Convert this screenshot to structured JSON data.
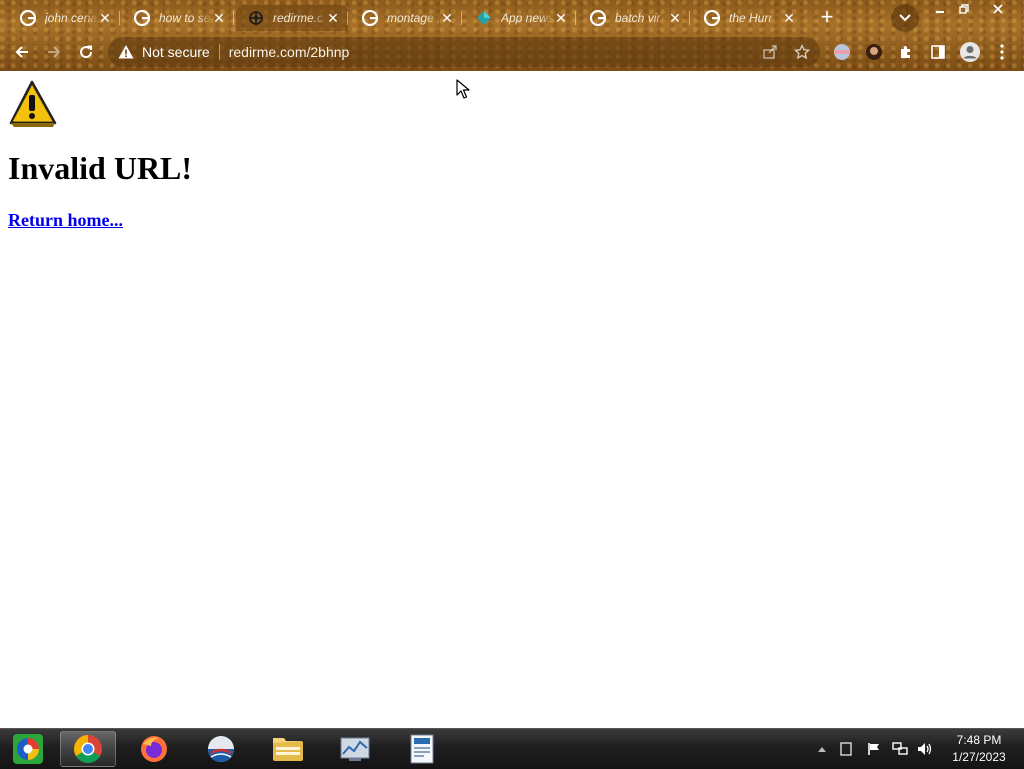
{
  "browser": {
    "tabs": [
      {
        "title": "john cena",
        "favicon": "google-icon"
      },
      {
        "title": "how to se",
        "favicon": "google-icon"
      },
      {
        "title": "redirme.c",
        "favicon": "redirme-icon"
      },
      {
        "title": "montage p",
        "favicon": "google-icon"
      },
      {
        "title": "App news",
        "favicon": "app-news-icon"
      },
      {
        "title": "batch vir",
        "favicon": "google-icon"
      },
      {
        "title": "the Hurr",
        "favicon": "google-icon"
      }
    ],
    "active_tab_index": 2,
    "tab_close_glyph": "✕",
    "new_tab_glyph": "+",
    "address_bar": {
      "security_label": "Not secure",
      "url": "redirme.com/2bhnp"
    }
  },
  "page": {
    "heading": "Invalid URL!",
    "link_text": "Return home..."
  },
  "taskbar": {
    "apps": [
      "start-orb",
      "chrome",
      "firefox",
      "opera",
      "file-explorer",
      "task-manager",
      "wordpad"
    ],
    "time": "7:48 PM",
    "date": "1/27/2023"
  },
  "colors": {
    "link": "#0000ee",
    "chrome_theme": "#8c5a1c",
    "taskbar": "#1e1e1e"
  }
}
